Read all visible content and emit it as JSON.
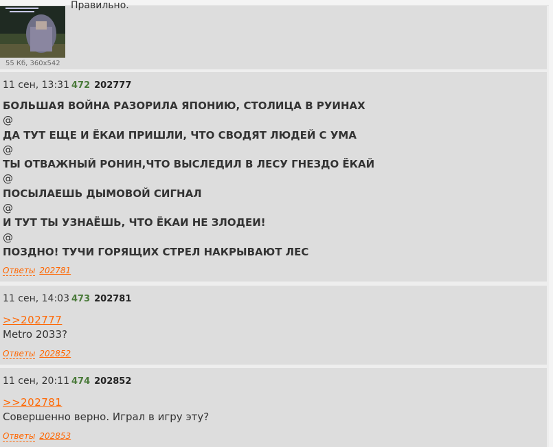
{
  "top_post": {
    "file_info": "55 Кб, 360x542",
    "cut_text": "Правильно."
  },
  "posts": [
    {
      "date": "11 сен, 13:31",
      "number": "472",
      "id": "202777",
      "lines": [
        "БОЛЬШАЯ ВОЙНА РАЗОРИЛА ЯПОНИЮ, СТОЛИЦА В РУИНАХ",
        "@",
        "ДА ТУТ ЕЩЕ И ЁКАИ ПРИШЛИ, ЧТО СВОДЯТ ЛЮДЕЙ С УМА",
        "@",
        "ТЫ ОТВАЖНЫЙ РОНИН,ЧТО ВЫСЛЕДИЛ В ЛЕСУ ГНЕЗДО ЁКАЙ",
        "@",
        "ПОСЫЛАЕШЬ ДЫМОВОЙ СИГНАЛ",
        "@",
        "И ТУТ ТЫ УЗНАЁШЬ, ЧТО ЁКАИ НЕ ЗЛОДЕИ!",
        "@",
        "ПОЗДНО! ТУЧИ ГОРЯЩИХ СТРЕЛ НАКРЫВАЮТ ЛЕС"
      ],
      "replies_label": "Ответы",
      "reply": "202781"
    },
    {
      "date": "11 сен, 14:03",
      "number": "473",
      "id": "202781",
      "quote": ">>202777",
      "text": "Metro 2033?",
      "replies_label": "Ответы",
      "reply": "202852"
    },
    {
      "date": "11 сен, 20:11",
      "number": "474",
      "id": "202852",
      "quote": ">>202781",
      "text": "Совершенно верно. Играл в игру эту?",
      "replies_label": "Ответы",
      "reply": "202853"
    }
  ],
  "colors": {
    "post_bg": "#dddddd",
    "page_bg": "#eeeeee",
    "link": "#ff6600",
    "post_number": "#4a7a3a"
  }
}
